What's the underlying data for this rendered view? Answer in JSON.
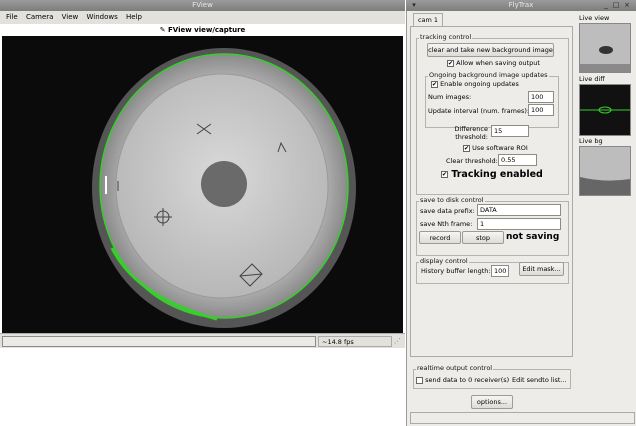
{
  "fview": {
    "title": "FView",
    "menu": [
      "File",
      "Camera",
      "View",
      "Windows",
      "Help"
    ],
    "toolbar_label": "FView view/capture",
    "fps": "~14.8 fps"
  },
  "flytrax": {
    "title": "FlyTrax",
    "tab": "cam 1",
    "tracking_control": {
      "legend": "tracking control",
      "bg_button": "clear and take new background image",
      "allow_saving": "Allow when saving output",
      "ongoing_legend": "Ongoing background image updates",
      "enable_ongoing": "Enable ongoing updates",
      "num_images_label": "Num images:",
      "num_images_value": "100",
      "update_interval_label": "Update interval (num. frames):",
      "update_interval_value": "100",
      "diff_label_1": "Difference",
      "diff_label_2": "threshold:",
      "diff_value": "15",
      "software_roi": "Use software ROI",
      "clear_label": "Clear threshold:",
      "clear_value": "0.55",
      "tracking_enabled": "Tracking enabled"
    },
    "save_control": {
      "legend": "save to disk control",
      "prefix_label": "save data prefix:",
      "prefix_value": "DATA",
      "nth_label": "save Nth frame:",
      "nth_value": "1",
      "record": "record",
      "stop": "stop",
      "status": "not saving"
    },
    "display_control": {
      "legend": "display control",
      "history_label": "History buffer length:",
      "history_value": "100",
      "edit_mask": "Edit mask..."
    },
    "realtime": {
      "legend": "realtime output control",
      "send_label": "send data to 0 receiver(s)",
      "edit_sendto": "Edit sendto list..."
    },
    "options": "options...",
    "thumbs": {
      "live_view": "Live view",
      "live_diff": "Live diff",
      "live_bg": "Live bg"
    }
  },
  "colors": {
    "track_green": "#35d02a",
    "panel_bg": "#edece9"
  }
}
